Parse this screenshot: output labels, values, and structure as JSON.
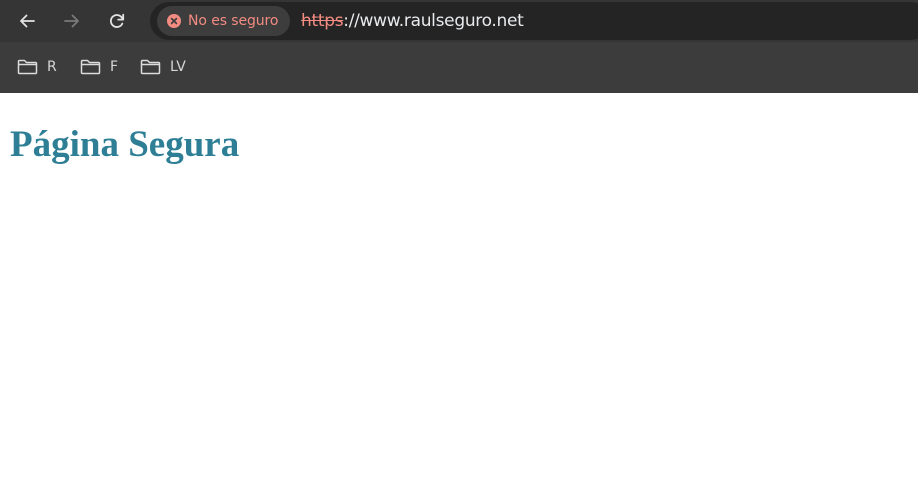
{
  "browser": {
    "security_label": "No es seguro",
    "url_scheme": "https",
    "url_rest": "://www.raulseguro.net",
    "security_color": "#f28b82",
    "nav": {
      "back": "arrow-left-icon",
      "forward": "arrow-right-icon",
      "reload": "reload-icon",
      "forward_enabled": false
    }
  },
  "bookmarks": [
    {
      "label": "R",
      "icon": "folder-icon"
    },
    {
      "label": "F",
      "icon": "folder-icon"
    },
    {
      "label": "LV",
      "icon": "folder-icon"
    }
  ],
  "page": {
    "title": "Página Segura",
    "title_color": "#2e7f95"
  }
}
